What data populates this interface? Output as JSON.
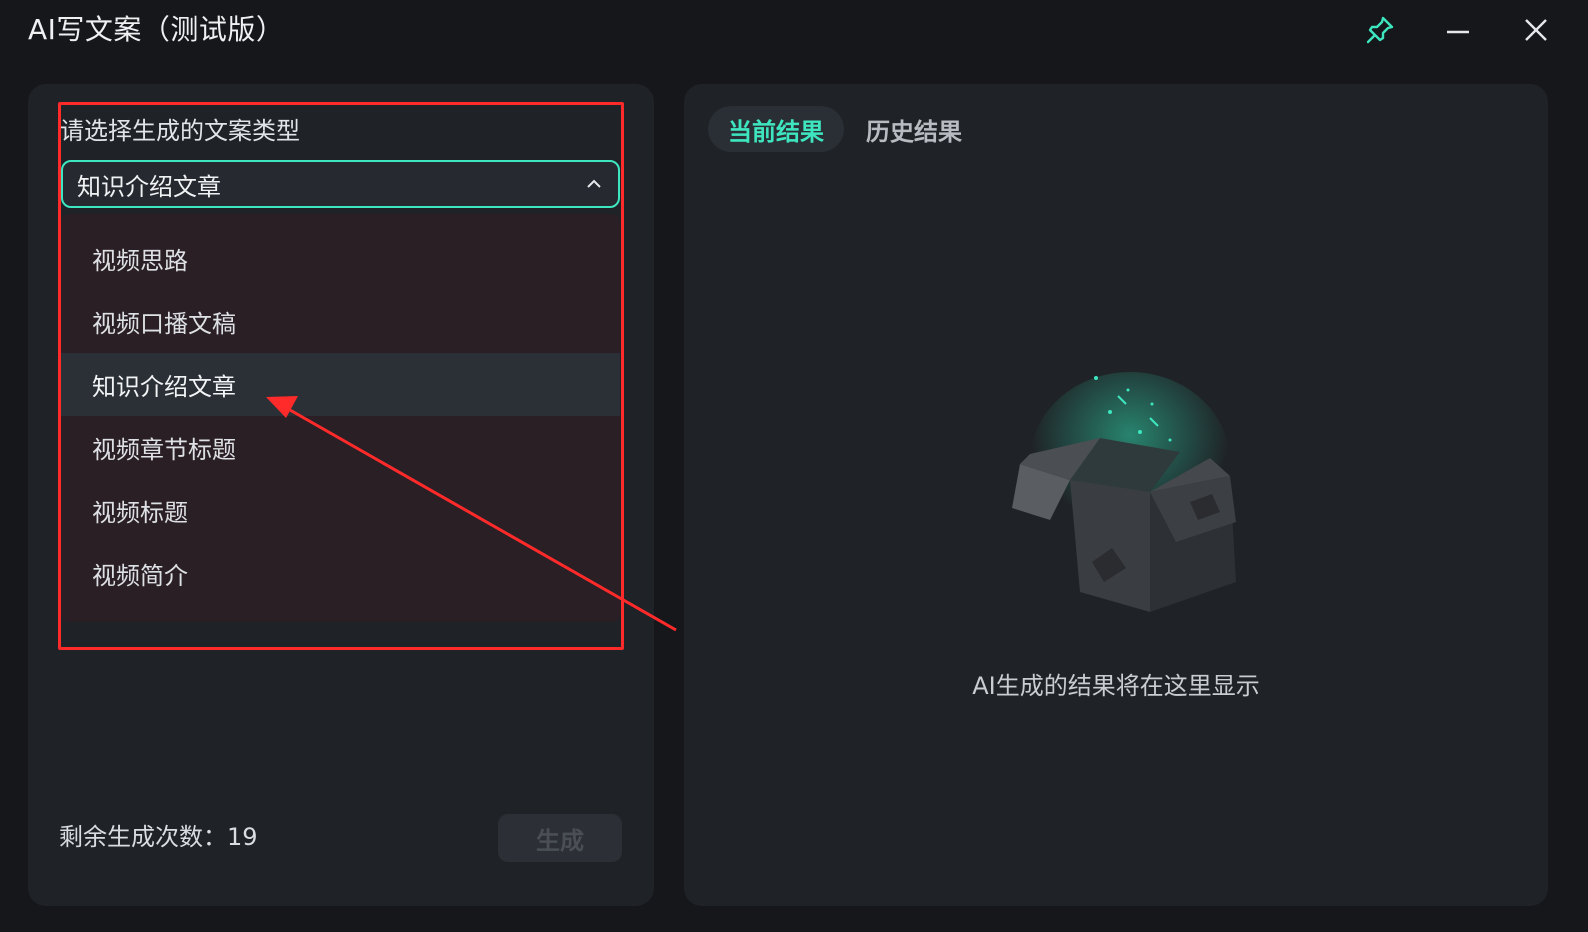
{
  "window": {
    "title": "AI写文案（测试版）"
  },
  "colors": {
    "accent": "#3ee6bf",
    "annotation": "#ff2a2a"
  },
  "left": {
    "label": "请选择生成的文案类型",
    "selected": "知识介绍文章",
    "options": [
      "视频思路",
      "视频口播文稿",
      "知识介绍文章",
      "视频章节标题",
      "视频标题",
      "视频简介"
    ],
    "remaining_text": "剩余生成次数：19",
    "generate_label": "生成"
  },
  "right": {
    "tabs": [
      "当前结果",
      "历史结果"
    ],
    "empty_text": "AI生成的结果将在这里显示"
  },
  "icons": {
    "pin": "pin-icon",
    "minimize": "minimize-icon",
    "close": "close-icon",
    "chevron": "chevron-up-icon",
    "empty": "open-box-icon"
  }
}
